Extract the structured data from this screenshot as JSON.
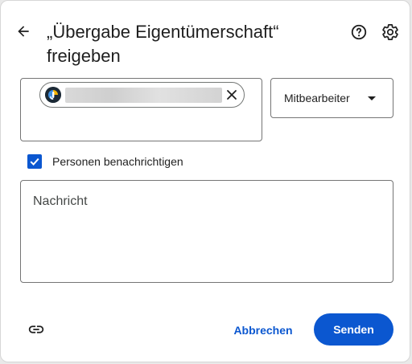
{
  "dialog": {
    "title_line1": "„Übergabe Eigentümerschaft“",
    "title_line2": "freigeben"
  },
  "header": {
    "back_icon": "arrow-back-icon",
    "help_icon": "help-circle-icon",
    "settings_icon": "gear-icon"
  },
  "recipients": {
    "chip_avatar_icon": "user-avatar",
    "chip_remove_icon": "close-icon"
  },
  "role": {
    "selected": "Mitbearbeiter"
  },
  "notify": {
    "checked": true,
    "label": "Personen benachrichtigen"
  },
  "message": {
    "placeholder": "Nachricht"
  },
  "footer": {
    "link_icon": "link-icon",
    "cancel_label": "Abbrechen",
    "send_label": "Senden"
  },
  "colors": {
    "accent": "#0b57d0",
    "text": "#1f1f1f",
    "border": "#757575"
  }
}
